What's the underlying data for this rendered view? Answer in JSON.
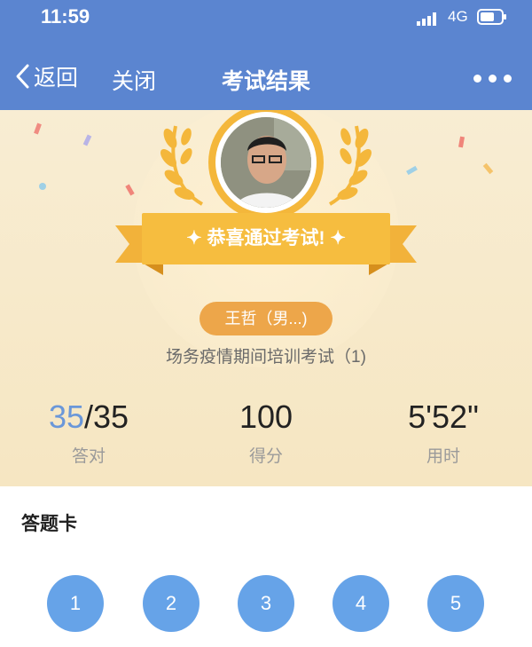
{
  "status_bar": {
    "time": "11:59",
    "network": "4G"
  },
  "nav": {
    "back_label": "返回",
    "close_label": "关闭",
    "title": "考试结果"
  },
  "result": {
    "banner_text": "✦ 恭喜通过考试! ✦",
    "user_name": "王哲（男...)",
    "exam_name": "场务疫情期间培训考试（1)",
    "stats": {
      "correct": "35",
      "total": "/35",
      "correct_label": "答对",
      "score": "100",
      "score_label": "得分",
      "time_used": "5'52\"",
      "time_label": "用时"
    }
  },
  "answer_card": {
    "title": "答题卡",
    "questions": [
      "1",
      "2",
      "3",
      "4",
      "5"
    ]
  },
  "colors": {
    "nav_bg": "#5b85d0",
    "accent": "#f4b73b",
    "pill": "#eda64a",
    "question": "#66a3e8",
    "highlight": "#6a97d9"
  },
  "icons": [
    "signal-icon",
    "battery-icon",
    "back-chevron-icon",
    "more-icon",
    "laurel-icon",
    "ribbon-icon"
  ]
}
